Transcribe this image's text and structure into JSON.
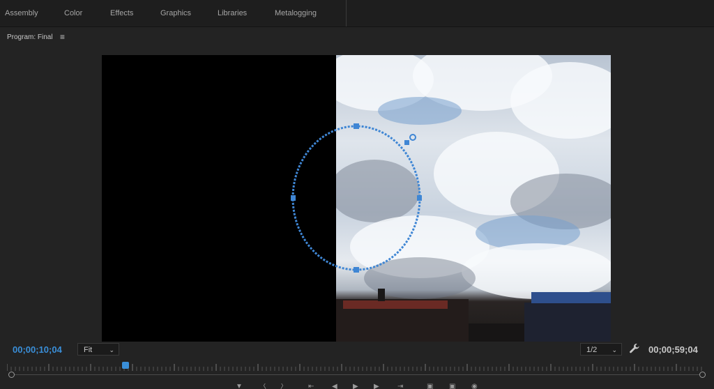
{
  "workspace_tabs": [
    {
      "label": "Assembly"
    },
    {
      "label": "Color"
    },
    {
      "label": "Effects"
    },
    {
      "label": "Graphics"
    },
    {
      "label": "Libraries"
    },
    {
      "label": "Metalogging"
    }
  ],
  "panel": {
    "title": "Program: Final",
    "menu_icon": "hamburger-menu-icon"
  },
  "viewer": {
    "mask_shape": "ellipse-mask",
    "mask_color": "#3f86d4"
  },
  "timecode": {
    "current": "00;00;10;04",
    "duration": "00;00;59;04",
    "current_color": "#3a8fd9"
  },
  "zoom": {
    "selected": "Fit"
  },
  "resolution": {
    "selected": "1/2"
  },
  "settings_icon": "wrench-icon",
  "playhead_position_fraction": 0.17,
  "transport_icons": [
    "add-marker-icon",
    "mark-in-icon",
    "mark-out-icon",
    "go-to-in-icon",
    "step-back-icon",
    "play-icon",
    "step-forward-icon",
    "go-to-out-icon",
    "lift-icon",
    "extract-icon",
    "export-frame-icon"
  ]
}
